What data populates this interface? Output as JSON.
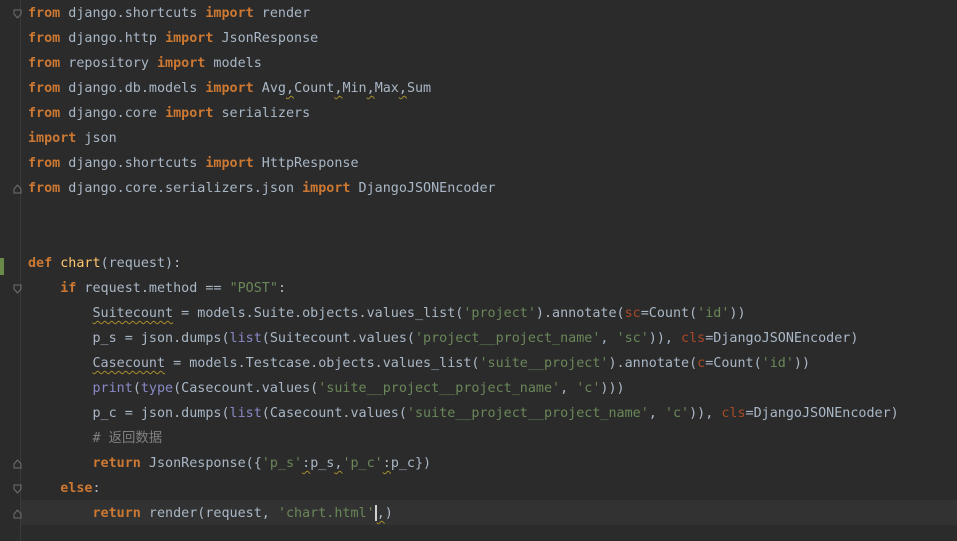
{
  "lines": [
    {
      "tokens": [
        {
          "c": "kw",
          "t": "from"
        },
        {
          "c": "plain",
          "t": " django.shortcuts "
        },
        {
          "c": "kw",
          "t": "import"
        },
        {
          "c": "plain",
          "t": " render"
        }
      ]
    },
    {
      "tokens": [
        {
          "c": "kw",
          "t": "from"
        },
        {
          "c": "plain",
          "t": " django.http "
        },
        {
          "c": "kw",
          "t": "import"
        },
        {
          "c": "plain",
          "t": " JsonResponse"
        }
      ]
    },
    {
      "tokens": [
        {
          "c": "kw",
          "t": "from"
        },
        {
          "c": "plain",
          "t": " repository "
        },
        {
          "c": "kw",
          "t": "import"
        },
        {
          "c": "plain",
          "t": " models"
        }
      ]
    },
    {
      "tokens": [
        {
          "c": "kw",
          "t": "from"
        },
        {
          "c": "plain",
          "t": " django.db.models "
        },
        {
          "c": "kw",
          "t": "import"
        },
        {
          "c": "plain",
          "t": " Avg"
        },
        {
          "c": "plain squig",
          "t": ","
        },
        {
          "c": "plain",
          "t": "Count"
        },
        {
          "c": "plain squig",
          "t": ","
        },
        {
          "c": "plain",
          "t": "Min"
        },
        {
          "c": "plain squig",
          "t": ","
        },
        {
          "c": "plain",
          "t": "Max"
        },
        {
          "c": "plain squig",
          "t": ","
        },
        {
          "c": "plain",
          "t": "Sum"
        }
      ]
    },
    {
      "tokens": [
        {
          "c": "kw",
          "t": "from"
        },
        {
          "c": "plain",
          "t": " django.core "
        },
        {
          "c": "kw",
          "t": "import"
        },
        {
          "c": "plain",
          "t": " serializers"
        }
      ]
    },
    {
      "tokens": [
        {
          "c": "kw",
          "t": "import"
        },
        {
          "c": "plain",
          "t": " json"
        }
      ]
    },
    {
      "tokens": [
        {
          "c": "kw",
          "t": "from"
        },
        {
          "c": "plain",
          "t": " django.shortcuts "
        },
        {
          "c": "kw",
          "t": "import"
        },
        {
          "c": "plain",
          "t": " HttpResponse"
        }
      ]
    },
    {
      "tokens": [
        {
          "c": "kw",
          "t": "from"
        },
        {
          "c": "plain",
          "t": " django.core.serializers.json "
        },
        {
          "c": "kw",
          "t": "import"
        },
        {
          "c": "plain",
          "t": " DjangoJSONEncoder"
        }
      ]
    },
    {
      "tokens": []
    },
    {
      "tokens": []
    },
    {
      "tokens": [
        {
          "c": "kw",
          "t": "def"
        },
        {
          "c": "plain",
          "t": " "
        },
        {
          "c": "fn",
          "t": "chart"
        },
        {
          "c": "plain",
          "t": "(request):"
        }
      ]
    },
    {
      "tokens": [
        {
          "c": "plain",
          "t": "    "
        },
        {
          "c": "kw",
          "t": "if"
        },
        {
          "c": "plain",
          "t": " request.method == "
        },
        {
          "c": "dstr",
          "t": "\"POST\""
        },
        {
          "c": "plain",
          "t": ":"
        }
      ]
    },
    {
      "tokens": [
        {
          "c": "plain",
          "t": "        "
        },
        {
          "c": "plain squig",
          "t": "Suitecount"
        },
        {
          "c": "plain",
          "t": " = models.Suite.objects.values_list("
        },
        {
          "c": "str",
          "t": "'project'"
        },
        {
          "c": "plain",
          "t": ").annotate("
        },
        {
          "c": "kwarg",
          "t": "sc"
        },
        {
          "c": "plain",
          "t": "=Count("
        },
        {
          "c": "str",
          "t": "'id'"
        },
        {
          "c": "plain",
          "t": "))"
        }
      ]
    },
    {
      "tokens": [
        {
          "c": "plain",
          "t": "        p_s = json.dumps("
        },
        {
          "c": "builtin",
          "t": "list"
        },
        {
          "c": "plain",
          "t": "(Suitecount.values("
        },
        {
          "c": "str",
          "t": "'project__project_name'"
        },
        {
          "c": "plain",
          "t": ", "
        },
        {
          "c": "str",
          "t": "'sc'"
        },
        {
          "c": "plain",
          "t": ")), "
        },
        {
          "c": "kwarg",
          "t": "cls"
        },
        {
          "c": "plain",
          "t": "=DjangoJSONEncoder)"
        }
      ]
    },
    {
      "tokens": [
        {
          "c": "plain",
          "t": "        "
        },
        {
          "c": "plain squig",
          "t": "Casecount"
        },
        {
          "c": "plain",
          "t": " = models.Testcase.objects.values_list("
        },
        {
          "c": "str",
          "t": "'suite__project'"
        },
        {
          "c": "plain",
          "t": ").annotate("
        },
        {
          "c": "kwarg",
          "t": "c"
        },
        {
          "c": "plain",
          "t": "=Count("
        },
        {
          "c": "str",
          "t": "'id'"
        },
        {
          "c": "plain",
          "t": "))"
        }
      ]
    },
    {
      "tokens": [
        {
          "c": "plain",
          "t": "        "
        },
        {
          "c": "builtin",
          "t": "print"
        },
        {
          "c": "plain",
          "t": "("
        },
        {
          "c": "builtin",
          "t": "type"
        },
        {
          "c": "plain",
          "t": "(Casecount.values("
        },
        {
          "c": "str",
          "t": "'suite__project__project_name'"
        },
        {
          "c": "plain",
          "t": ", "
        },
        {
          "c": "str",
          "t": "'c'"
        },
        {
          "c": "plain",
          "t": ")))"
        }
      ]
    },
    {
      "tokens": [
        {
          "c": "plain",
          "t": "        p_c = json.dumps("
        },
        {
          "c": "builtin",
          "t": "list"
        },
        {
          "c": "plain",
          "t": "(Casecount.values("
        },
        {
          "c": "str",
          "t": "'suite__project__project_name'"
        },
        {
          "c": "plain",
          "t": ", "
        },
        {
          "c": "str",
          "t": "'c'"
        },
        {
          "c": "plain",
          "t": ")), "
        },
        {
          "c": "kwarg",
          "t": "cls"
        },
        {
          "c": "plain",
          "t": "=DjangoJSONEncoder)"
        }
      ]
    },
    {
      "tokens": [
        {
          "c": "plain",
          "t": "        "
        },
        {
          "c": "comment",
          "t": "# 返回数据"
        }
      ]
    },
    {
      "tokens": [
        {
          "c": "plain",
          "t": "        "
        },
        {
          "c": "kw",
          "t": "return"
        },
        {
          "c": "plain",
          "t": " JsonResponse({"
        },
        {
          "c": "str",
          "t": "'p_s'"
        },
        {
          "c": "plain squig",
          "t": ":"
        },
        {
          "c": "plain",
          "t": "p_s"
        },
        {
          "c": "plain squig",
          "t": ","
        },
        {
          "c": "str",
          "t": "'p_c'"
        },
        {
          "c": "plain squig",
          "t": ":"
        },
        {
          "c": "plain",
          "t": "p_c})"
        }
      ]
    },
    {
      "tokens": [
        {
          "c": "plain",
          "t": "    "
        },
        {
          "c": "kw",
          "t": "else"
        },
        {
          "c": "plain",
          "t": ":"
        }
      ]
    },
    {
      "tokens": [
        {
          "c": "plain",
          "t": "        "
        },
        {
          "c": "kw",
          "t": "return"
        },
        {
          "c": "plain",
          "t": " render(request, "
        },
        {
          "c": "str",
          "t": "'chart.html'"
        },
        {
          "c": "caret",
          "t": ""
        },
        {
          "c": "plain squig",
          "t": ","
        },
        {
          "c": "plain",
          "t": ")"
        }
      ]
    }
  ],
  "folds": [
    {
      "line": 0,
      "shape": "open-top"
    },
    {
      "line": 7,
      "shape": "close-bottom"
    },
    {
      "line": 11,
      "shape": "open-top"
    },
    {
      "line": 18,
      "shape": "close-bottom"
    },
    {
      "line": 19,
      "shape": "open-top"
    },
    {
      "line": 20,
      "shape": "close-bottom"
    }
  ],
  "colors": {
    "background": "#2b2b2b",
    "keyword": "#cc7832",
    "string": "#6a8759",
    "function": "#ffc66d",
    "builtin": "#8888c6",
    "kwarg": "#aa4926",
    "comment": "#808080",
    "text": "#a9b7c6"
  }
}
